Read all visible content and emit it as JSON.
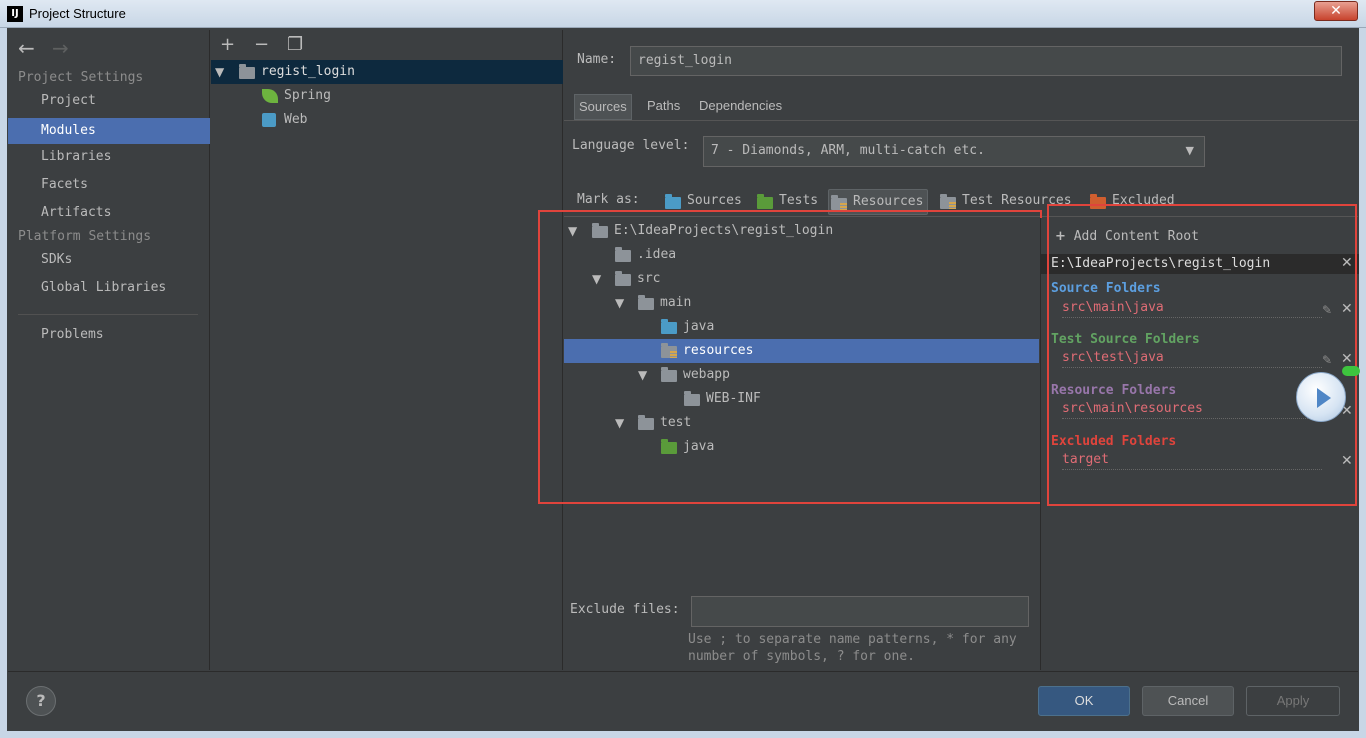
{
  "window": {
    "title": "Project Structure",
    "app_icon": "intellij-icon"
  },
  "nav": {
    "back": "←",
    "forward": "→",
    "project_settings": "Project Settings",
    "items_project": [
      "Project",
      "Modules",
      "Libraries",
      "Facets",
      "Artifacts"
    ],
    "platform_settings": "Platform Settings",
    "items_platform": [
      "SDKs",
      "Global Libraries"
    ],
    "problems": "Problems",
    "selected": "Modules"
  },
  "modules": {
    "toolbar": {
      "add": "+",
      "remove": "−",
      "copy": "❐"
    },
    "root": "regist_login",
    "children": [
      "Spring",
      "Web"
    ]
  },
  "module": {
    "name_label": "Name:",
    "name_value": "regist_login",
    "tabs": [
      "Sources",
      "Paths",
      "Dependencies"
    ],
    "active_tab": "Sources",
    "language_level_label": "Language level:",
    "language_level_value": "7 - Diamonds, ARM, multi-catch etc.",
    "mark_as_label": "Mark as:",
    "mark_as": [
      "Sources",
      "Tests",
      "Resources",
      "Test Resources",
      "Excluded"
    ],
    "tree": [
      {
        "label": "E:\\IdeaProjects\\regist_login",
        "depth": 0,
        "expanded": true,
        "icon": "folder-gray"
      },
      {
        "label": ".idea",
        "depth": 1,
        "icon": "folder-gray"
      },
      {
        "label": "src",
        "depth": 1,
        "expanded": true,
        "icon": "folder-gray"
      },
      {
        "label": "main",
        "depth": 2,
        "expanded": true,
        "icon": "folder-gray"
      },
      {
        "label": "java",
        "depth": 3,
        "icon": "folder-blue"
      },
      {
        "label": "resources",
        "depth": 3,
        "icon": "folder-resources",
        "selected": true
      },
      {
        "label": "webapp",
        "depth": 3,
        "expanded": true,
        "icon": "folder-gray"
      },
      {
        "label": "WEB-INF",
        "depth": 4,
        "icon": "folder-gray"
      },
      {
        "label": "test",
        "depth": 2,
        "expanded": true,
        "icon": "folder-gray"
      },
      {
        "label": "java",
        "depth": 3,
        "icon": "folder-green"
      }
    ],
    "exclude_label": "Exclude files:",
    "exclude_value": "",
    "exclude_hint_1": "Use ; to separate name patterns, * for any",
    "exclude_hint_2": "number of symbols, ? for one."
  },
  "roots": {
    "add_content_root": "Add Content Root",
    "root_path": "E:\\IdeaProjects\\regist_login",
    "source_header": "Source Folders",
    "source_folder": "src\\main\\java",
    "test_header": "Test Source Folders",
    "test_folder": "src\\test\\java",
    "resource_header": "Resource Folders",
    "resource_folder": "src\\main\\resources",
    "excluded_header": "Excluded Folders",
    "excluded_folder": "target"
  },
  "colors": {
    "selection": "#4b6eaf",
    "source": "#5c9fe0",
    "test": "#62a362",
    "resource": "#9876aa",
    "excluded": "#e0443c",
    "highlight_box": "#e0443c"
  },
  "footer": {
    "help": "?",
    "ok": "OK",
    "cancel": "Cancel",
    "apply": "Apply"
  }
}
